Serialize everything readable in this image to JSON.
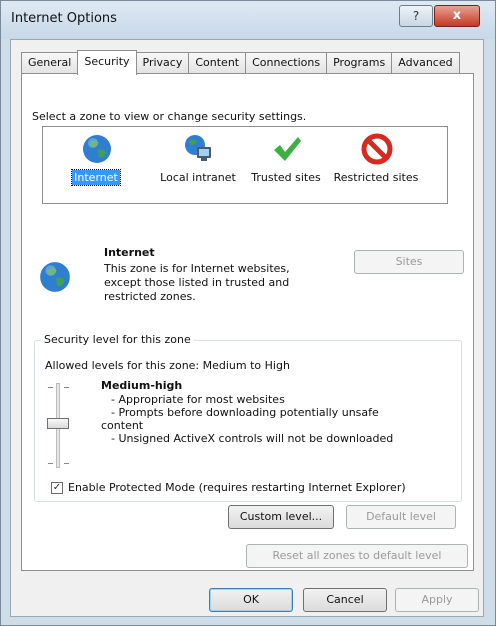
{
  "window": {
    "title": "Internet Options",
    "help_label": "?",
    "close_label": "x"
  },
  "tabs": [
    {
      "label": "General"
    },
    {
      "label": "Security"
    },
    {
      "label": "Privacy"
    },
    {
      "label": "Content"
    },
    {
      "label": "Connections"
    },
    {
      "label": "Programs"
    },
    {
      "label": "Advanced"
    }
  ],
  "security": {
    "zone_prompt": "Select a zone to view or change security settings.",
    "zones": [
      {
        "label": "Internet",
        "icon": "globe-icon"
      },
      {
        "label": "Local intranet",
        "icon": "intranet-icon"
      },
      {
        "label": "Trusted sites",
        "icon": "checkmark-icon"
      },
      {
        "label": "Restricted sites",
        "icon": "restricted-icon"
      }
    ],
    "selected_zone": {
      "name": "Internet",
      "description": "This zone is for Internet websites, except those listed in trusted and restricted zones."
    },
    "sites_button": "Sites",
    "level_group": {
      "legend": "Security level for this zone",
      "allowed": "Allowed levels for this zone: Medium to High",
      "level_name": "Medium-high",
      "level_desc": [
        "- Appropriate for most websites",
        "- Prompts before downloading potentially unsafe",
        "content",
        "- Unsigned ActiveX controls will not be downloaded"
      ],
      "protected_mode_label": "Enable Protected Mode (requires restarting Internet Explorer)",
      "protected_mode_checked": true,
      "custom_level": "Custom level...",
      "default_level": "Default level"
    },
    "reset_all": "Reset all zones to default level"
  },
  "footer": {
    "ok": "OK",
    "cancel": "Cancel",
    "apply": "Apply"
  },
  "colors": {
    "selection": "#3399ff",
    "close_red": "#c23a24"
  }
}
